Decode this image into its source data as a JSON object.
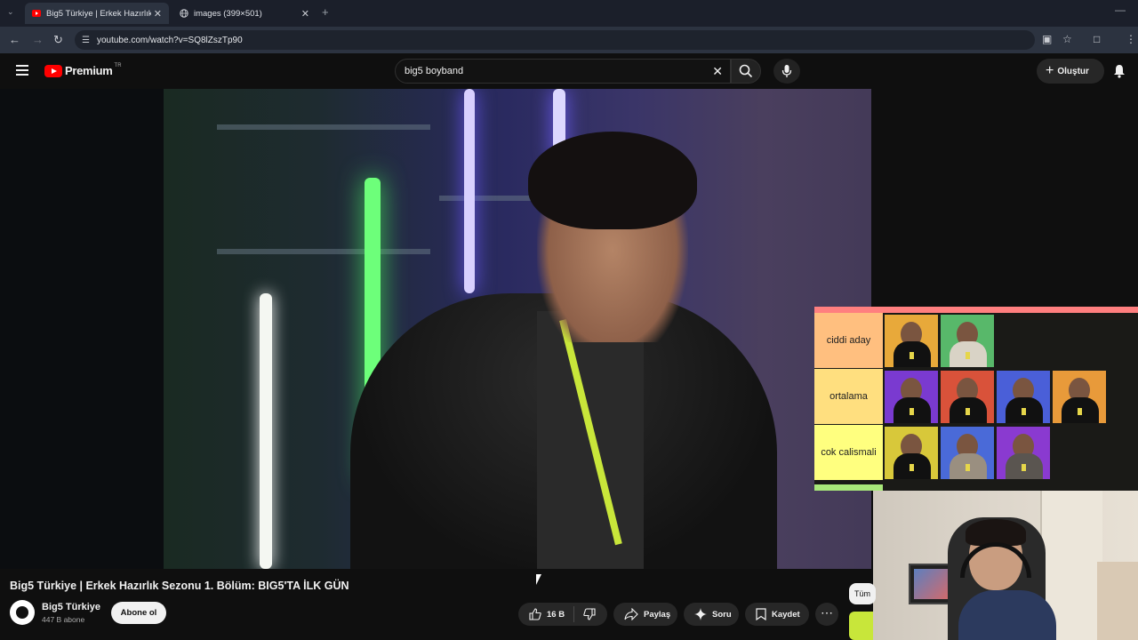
{
  "browser": {
    "tabs": [
      {
        "title": "Big5 Türkiye | Erkek Hazırlık Se",
        "active": true
      },
      {
        "title": "images (399×501)",
        "active": false
      }
    ],
    "url": "youtube.com/watch?v=SQ8lZszTp90"
  },
  "youtube": {
    "logo_text": "Premium",
    "country": "TR",
    "search_value": "big5 boyband",
    "create_label": "Oluştur"
  },
  "tier_list": {
    "rows": [
      {
        "label": "ciddi aday",
        "color": "#ffbf7f",
        "count": 2
      },
      {
        "label": "ortalama",
        "color": "#ffdf7f",
        "count": 4
      },
      {
        "label": "cok calismali",
        "color": "#ffff7f",
        "count": 3
      }
    ]
  },
  "video": {
    "title": "Big5 Türkiye | Erkek Hazırlık Sezonu 1. Bölüm: BIG5'TA İLK GÜN",
    "channel": "Big5 Türkiye",
    "subscribers": "447 B abone",
    "subscribe_label": "Abone ol",
    "likes": "16 B",
    "share_label": "Paylaş",
    "ask_label": "Soru",
    "save_label": "Kaydet",
    "chip_label": "Tüm"
  },
  "colors": {
    "background": "#0f0f0f",
    "brand_red": "#ff0000",
    "lanyard": "#c8e63a"
  }
}
